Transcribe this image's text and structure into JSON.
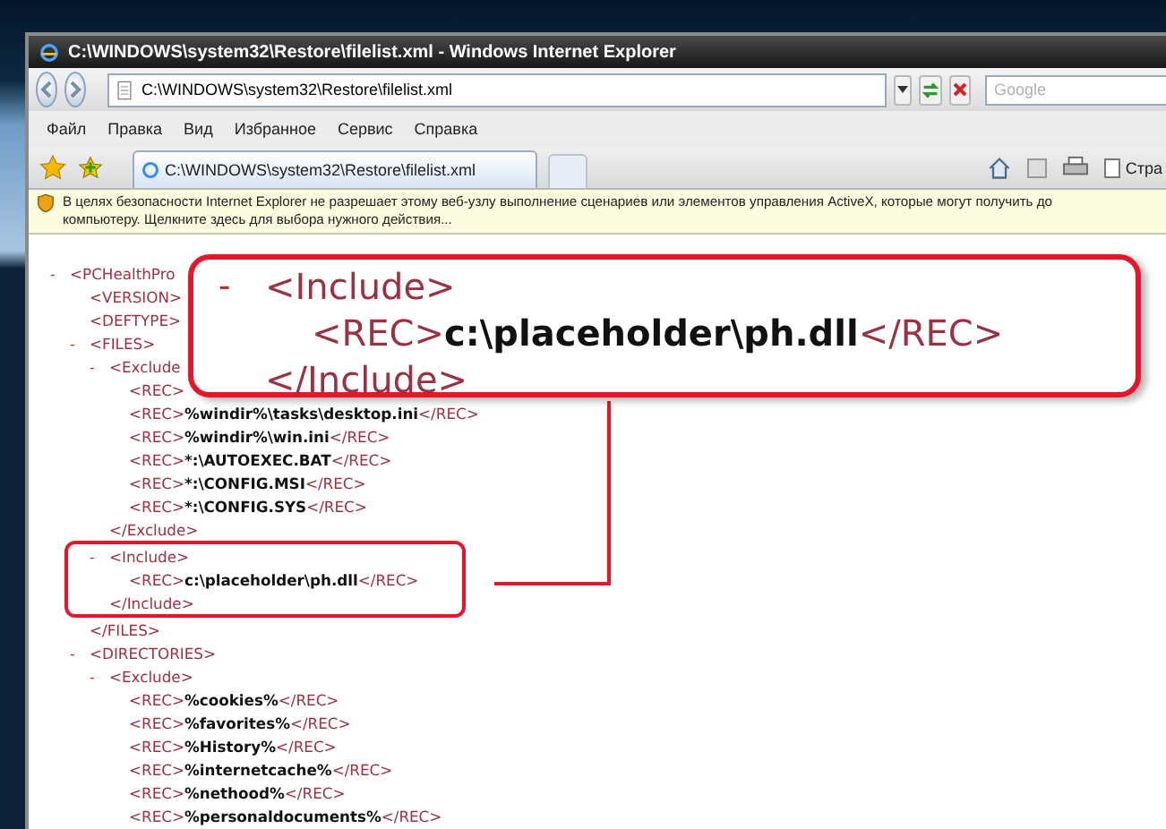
{
  "window": {
    "title": "C:\\WINDOWS\\system32\\Restore\\filelist.xml - Windows Internet Explorer"
  },
  "address_bar": {
    "value": "C:\\WINDOWS\\system32\\Restore\\filelist.xml"
  },
  "search": {
    "placeholder": "Google"
  },
  "menu": [
    "Файл",
    "Правка",
    "Вид",
    "Избранное",
    "Сервис",
    "Справка"
  ],
  "tabs": [
    {
      "label": "C:\\WINDOWS\\system32\\Restore\\filelist.xml",
      "selected": true
    }
  ],
  "command_bar": {
    "page_label": "Стра"
  },
  "info_bar": {
    "lines": [
      "В целях безопасности Internet Explorer не разрешает этому веб-узлу выполнение сценариев или элементов управления ActiveX, которые могут получить до",
      "компьютеру. Щелкните здесь для выбора нужного действия..."
    ]
  },
  "document": {
    "toggle": "-",
    "open": [
      {
        "kind": "tag",
        "text": "<PCHealthPro"
      }
    ],
    "children": [
      {
        "parts": [
          {
            "kind": "tag",
            "text": "<VERSION>"
          }
        ]
      },
      {
        "parts": [
          {
            "kind": "tag",
            "text": "<DEFTYPE>"
          }
        ]
      },
      {
        "toggle": "-",
        "open": [
          {
            "kind": "tag",
            "text": "<FILES>"
          }
        ],
        "children": [
          {
            "toggle": "-",
            "open": [
              {
                "kind": "tag",
                "text": "<Exclude"
              }
            ],
            "children": [
              {
                "parts": [
                  {
                    "kind": "tag",
                    "text": "<REC>"
                  }
                ]
              },
              {
                "parts": [
                  {
                    "kind": "tag",
                    "text": "<REC>"
                  },
                  {
                    "kind": "value",
                    "text": "%windir%\\tasks\\desktop.ini"
                  },
                  {
                    "kind": "tag",
                    "text": "</REC>"
                  }
                ]
              },
              {
                "parts": [
                  {
                    "kind": "tag",
                    "text": "<REC>"
                  },
                  {
                    "kind": "value",
                    "text": "%windir%\\win.ini"
                  },
                  {
                    "kind": "tag",
                    "text": "</REC>"
                  }
                ]
              },
              {
                "parts": [
                  {
                    "kind": "tag",
                    "text": "<REC>"
                  },
                  {
                    "kind": "value",
                    "text": "*:\\AUTOEXEC.BAT"
                  },
                  {
                    "kind": "tag",
                    "text": "</REC>"
                  }
                ]
              },
              {
                "parts": [
                  {
                    "kind": "tag",
                    "text": "<REC>"
                  },
                  {
                    "kind": "value",
                    "text": "*:\\CONFIG.MSI"
                  },
                  {
                    "kind": "tag",
                    "text": "</REC>"
                  }
                ]
              },
              {
                "parts": [
                  {
                    "kind": "tag",
                    "text": "<REC>"
                  },
                  {
                    "kind": "value",
                    "text": "*:\\CONFIG.SYS"
                  },
                  {
                    "kind": "tag",
                    "text": "</REC>"
                  }
                ]
              }
            ],
            "close": [
              {
                "kind": "tag",
                "text": "</Exclude>"
              }
            ]
          },
          {
            "toggle": "-",
            "highlighted": true,
            "open": [
              {
                "kind": "tag",
                "text": "<Include>"
              }
            ],
            "children": [
              {
                "parts": [
                  {
                    "kind": "tag",
                    "text": "<REC>"
                  },
                  {
                    "kind": "value",
                    "text": "c:\\placeholder\\ph.dll"
                  },
                  {
                    "kind": "tag",
                    "text": "</REC>"
                  }
                ]
              }
            ],
            "close": [
              {
                "kind": "tag",
                "text": "</Include>"
              }
            ]
          }
        ],
        "close": [
          {
            "kind": "tag",
            "text": "</FILES>"
          }
        ]
      },
      {
        "toggle": "-",
        "open": [
          {
            "kind": "tag",
            "text": "<DIRECTORIES>"
          }
        ],
        "children": [
          {
            "toggle": "-",
            "open": [
              {
                "kind": "tag",
                "text": "<Exclude>"
              }
            ],
            "children": [
              {
                "parts": [
                  {
                    "kind": "tag",
                    "text": "<REC>"
                  },
                  {
                    "kind": "value",
                    "text": "%cookies%"
                  },
                  {
                    "kind": "tag",
                    "text": "</REC>"
                  }
                ]
              },
              {
                "parts": [
                  {
                    "kind": "tag",
                    "text": "<REC>"
                  },
                  {
                    "kind": "value",
                    "text": "%favorites%"
                  },
                  {
                    "kind": "tag",
                    "text": "</REC>"
                  }
                ]
              },
              {
                "parts": [
                  {
                    "kind": "tag",
                    "text": "<REC>"
                  },
                  {
                    "kind": "value",
                    "text": "%History%"
                  },
                  {
                    "kind": "tag",
                    "text": "</REC>"
                  }
                ]
              },
              {
                "parts": [
                  {
                    "kind": "tag",
                    "text": "<REC>"
                  },
                  {
                    "kind": "value",
                    "text": "%internetcache%"
                  },
                  {
                    "kind": "tag",
                    "text": "</REC>"
                  }
                ]
              },
              {
                "parts": [
                  {
                    "kind": "tag",
                    "text": "<REC>"
                  },
                  {
                    "kind": "value",
                    "text": "%nethood%"
                  },
                  {
                    "kind": "tag",
                    "text": "</REC>"
                  }
                ]
              },
              {
                "parts": [
                  {
                    "kind": "tag",
                    "text": "<REC>"
                  },
                  {
                    "kind": "value",
                    "text": "%personaldocuments%"
                  },
                  {
                    "kind": "tag",
                    "text": "</REC>"
                  }
                ]
              }
            ]
          }
        ]
      }
    ]
  },
  "callout": {
    "toggle": "-",
    "open": [
      {
        "kind": "tag",
        "text": "<Include>"
      }
    ],
    "children": [
      {
        "parts": [
          {
            "kind": "tag",
            "text": "<REC>"
          },
          {
            "kind": "value",
            "text": "c:\\placeholder\\ph.dll"
          },
          {
            "kind": "tag",
            "text": "</REC>"
          }
        ]
      }
    ],
    "close": [
      {
        "kind": "tag",
        "text": "</Include>"
      }
    ]
  }
}
